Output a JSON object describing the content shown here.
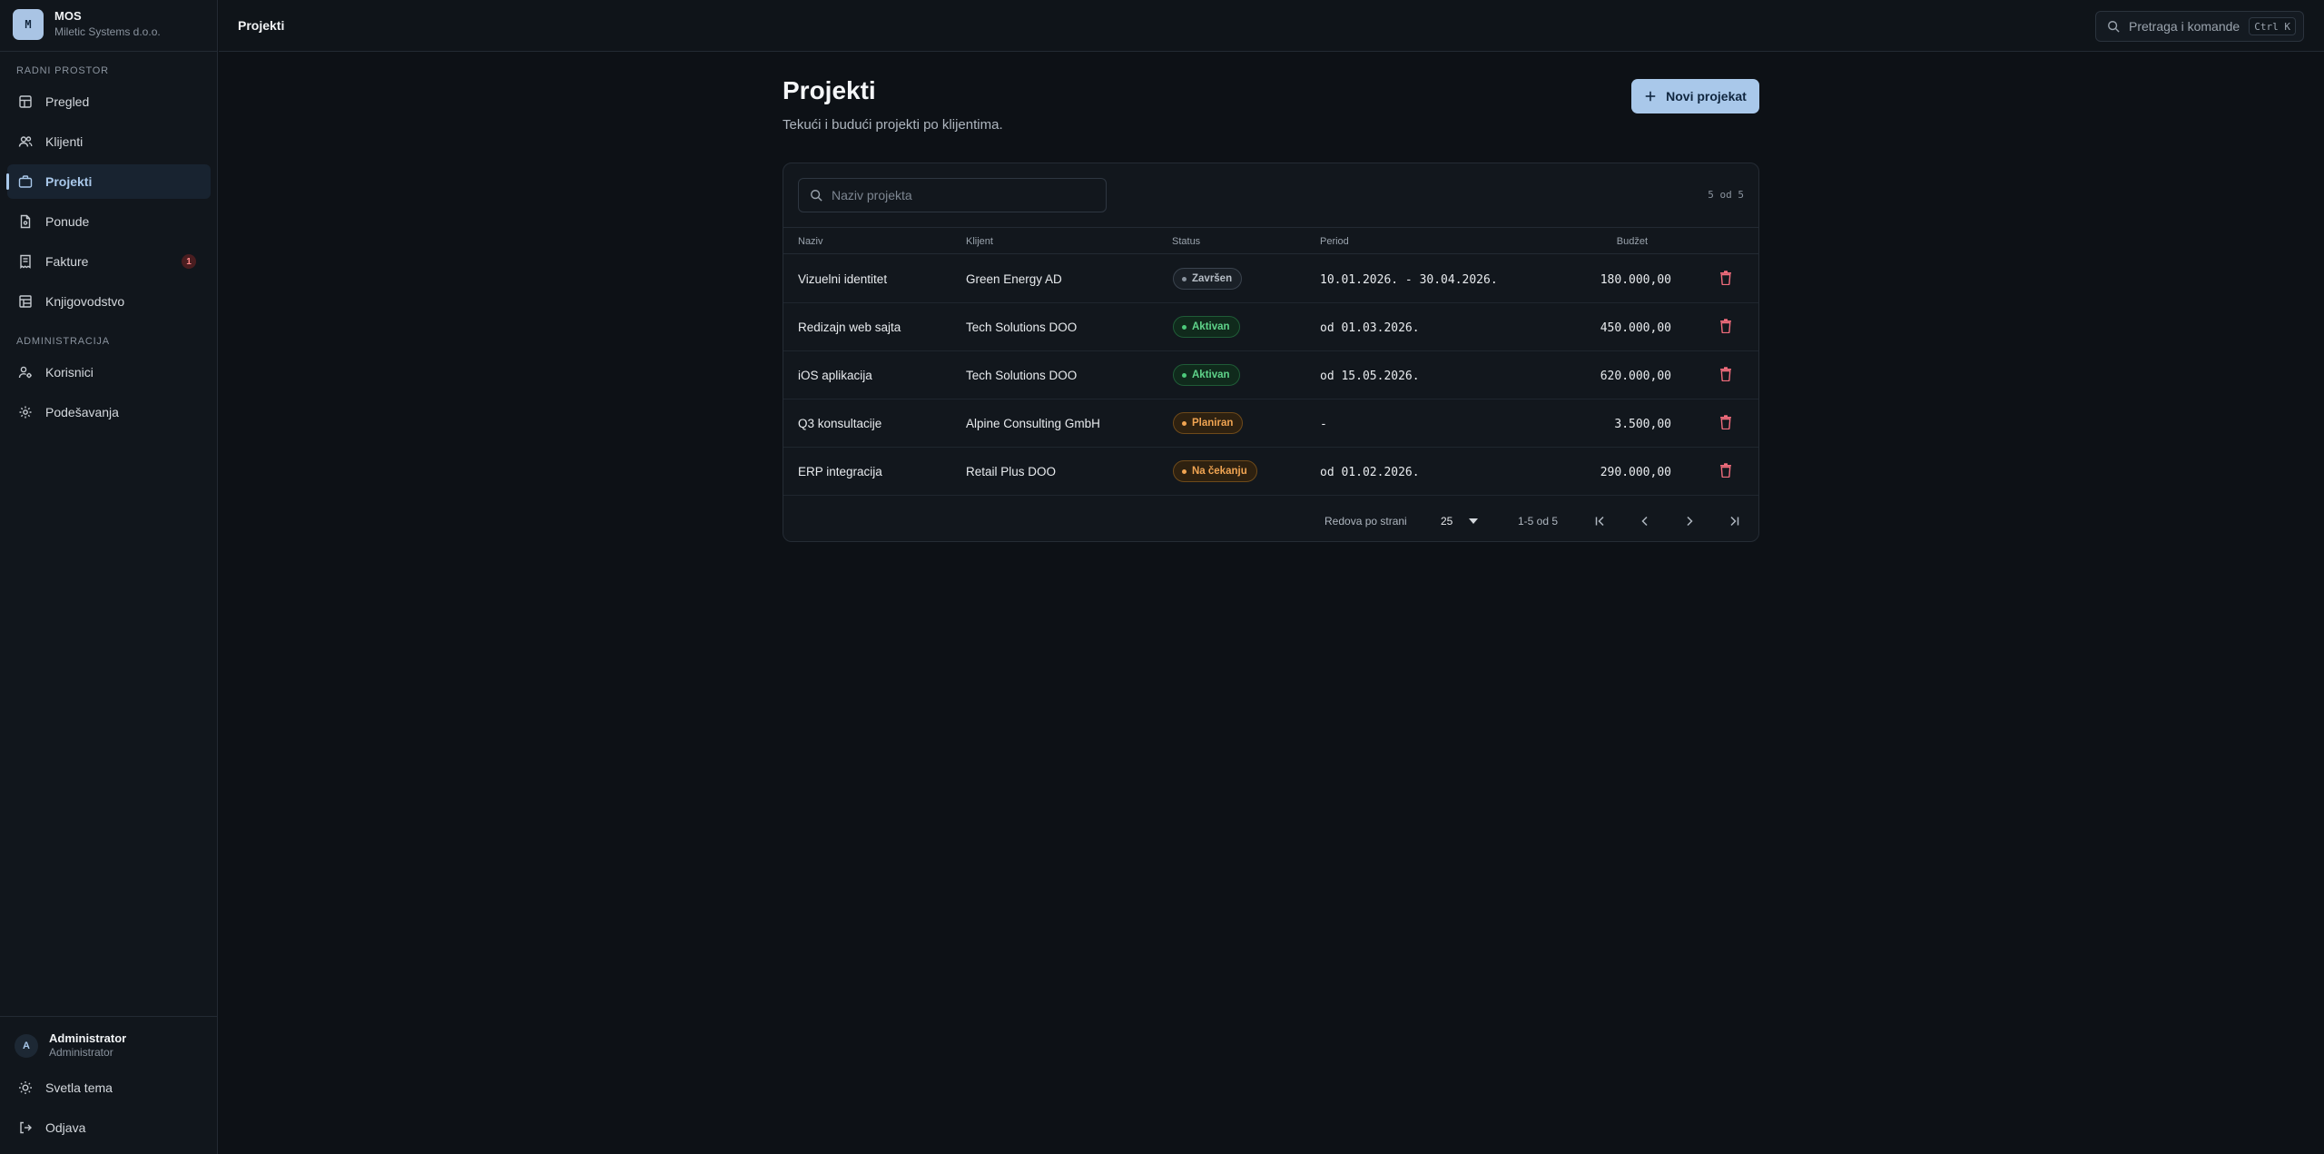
{
  "brand": {
    "logo_letter": "M",
    "name": "MOS",
    "company": "Miletic Systems d.o.o."
  },
  "sidebar": {
    "section_workspace": "RADNI PROSTOR",
    "section_admin": "ADMINISTRACIJA",
    "items": [
      {
        "label": "Pregled",
        "icon": "dashboard-icon"
      },
      {
        "label": "Klijenti",
        "icon": "users-icon"
      },
      {
        "label": "Projekti",
        "icon": "briefcase-icon",
        "active": true
      },
      {
        "label": "Ponude",
        "icon": "document-icon"
      },
      {
        "label": "Fakture",
        "icon": "receipt-icon",
        "badge": "1"
      },
      {
        "label": "Knjigovodstvo",
        "icon": "ledger-icon"
      },
      {
        "label": "Korisnici",
        "icon": "user-cog-icon"
      },
      {
        "label": "Podešavanja",
        "icon": "gear-icon"
      }
    ],
    "user": {
      "initial": "A",
      "name": "Administrator",
      "role": "Administrator"
    },
    "theme_toggle": "Svetla tema",
    "logout": "Odjava"
  },
  "topbar": {
    "title": "Projekti",
    "command_search_placeholder": "Pretraga i komande",
    "shortcut": "Ctrl K"
  },
  "page": {
    "title": "Projekti",
    "subtitle": "Tekući i budući projekti po klijentima.",
    "new_button": "Novi projekat"
  },
  "table": {
    "search_placeholder": "Naziv projekta",
    "count": "5 od 5",
    "columns": {
      "name": "Naziv",
      "client": "Klijent",
      "status": "Status",
      "period": "Period",
      "budget": "Budžet"
    },
    "rows": [
      {
        "name": "Vizuelni identitet",
        "client": "Green Energy AD",
        "status": "Završen",
        "period": "10.01.2026. - 30.04.2026.",
        "budget": "180.000,00"
      },
      {
        "name": "Redizajn web sajta",
        "client": "Tech Solutions DOO",
        "status": "Aktivan",
        "period": "od 01.03.2026.",
        "budget": "450.000,00"
      },
      {
        "name": "iOS aplikacija",
        "client": "Tech Solutions DOO",
        "status": "Aktivan",
        "period": "od 15.05.2026.",
        "budget": "620.000,00"
      },
      {
        "name": "Q3 konsultacije",
        "client": "Alpine Consulting GmbH",
        "status": "Planiran",
        "period": "-",
        "budget": "3.500,00"
      },
      {
        "name": "ERP integracija",
        "client": "Retail Plus DOO",
        "status": "Na čekanju",
        "period": "od 01.02.2026.",
        "budget": "290.000,00"
      }
    ],
    "pagination": {
      "rows_per_page_label": "Redova po strani",
      "rows_per_page": "25",
      "range": "1-5 od 5"
    }
  },
  "colors": {
    "accent": "#a9c8ea",
    "background": "#0d1116",
    "active_status": "#5fd38a",
    "pending_status": "#f0a452",
    "danger": "#f26d7d"
  }
}
